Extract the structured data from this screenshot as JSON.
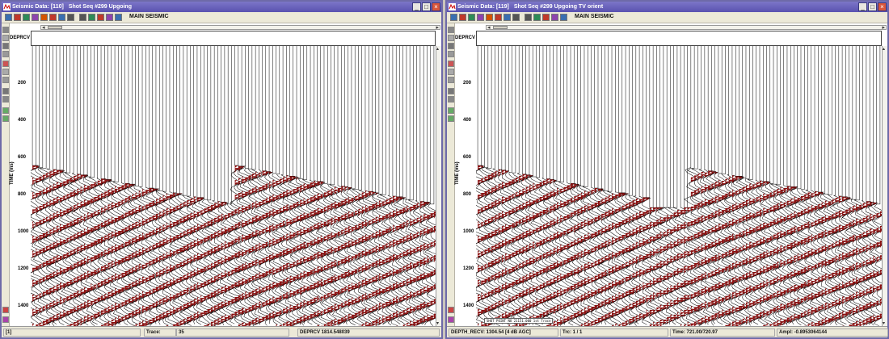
{
  "windows": [
    {
      "id": "left",
      "title": "Seismic Data: [110]",
      "subtitle": "Shot Seq #299 Upgoing",
      "toolbar_label": "MAIN SEISMIC",
      "axis_name": "DEPRCV",
      "ylabel": "TIME (ms)",
      "yticks": [
        "200",
        "400",
        "600",
        "800",
        "1000",
        "1200",
        "1400"
      ],
      "annotation": "",
      "status": [
        "[1]",
        "Trace:",
        "35",
        "DEPRCV 1814.548039",
        "",
        ""
      ]
    },
    {
      "id": "right",
      "title": "Seismic Data: [119]",
      "subtitle": "Shot Seq #299 Upgoing TV orient",
      "toolbar_label": "MAIN SEISMIC",
      "axis_name": "DEPRCV",
      "ylabel": "TIME (ms)",
      "yticks": [
        "200",
        "400",
        "600",
        "800",
        "1000",
        "1200",
        "1400"
      ],
      "annotation": "SHOT POINT NO 21151.000 1st Trace",
      "status": [
        "DEPTH_RECV: 1304.54 [4 dB AGC]",
        "Trc: 1 / 1",
        "",
        "Time: 721.00/720.97",
        "Ampl: -0.8953064144",
        ""
      ]
    }
  ],
  "icons": {
    "app": "seismic-app-icon",
    "minimize": "minimize-icon",
    "maximize": "maximize-icon",
    "close": "close-icon"
  },
  "colors": {
    "wiggle_fill": "#8b1010",
    "trace_line": "#000000",
    "titlebar": "#5a52b0"
  }
}
